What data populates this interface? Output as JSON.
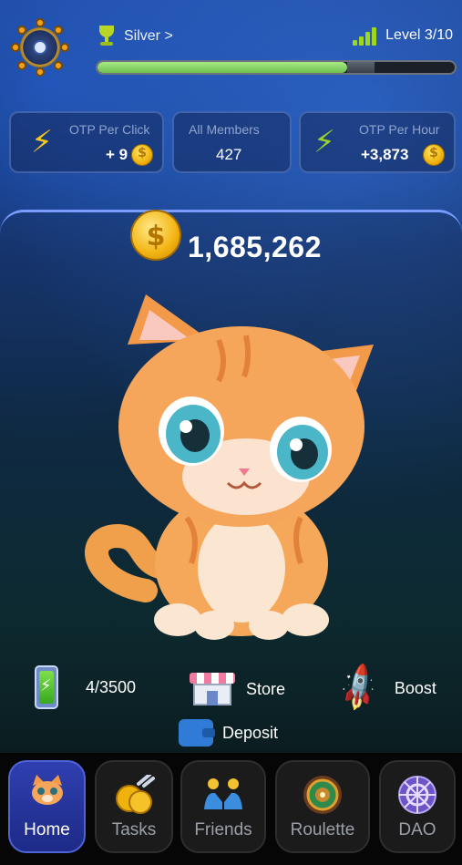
{
  "header": {
    "rank_label": "Silver >",
    "level_label": "Level 3/10",
    "level_progress": 0.7
  },
  "stats": {
    "per_click": {
      "label": "OTP Per Click",
      "value": "+ 9"
    },
    "members": {
      "label": "All Members",
      "value": "427"
    },
    "per_hour": {
      "label": "OTP Per Hour",
      "value": "+3,873"
    }
  },
  "balance": "1,685,262",
  "actions": {
    "energy": "4/3500",
    "store": "Store",
    "boost": "Boost",
    "deposit": "Deposit"
  },
  "nav": [
    {
      "label": "Home",
      "icon": "cat-face-icon",
      "active": true
    },
    {
      "label": "Tasks",
      "icon": "coins-icon",
      "active": false
    },
    {
      "label": "Friends",
      "icon": "friends-icon",
      "active": false
    },
    {
      "label": "Roulette",
      "icon": "roulette-icon",
      "active": false
    },
    {
      "label": "DAO",
      "icon": "dao-icon",
      "active": false
    }
  ],
  "colors": {
    "accent": "#7b9cff",
    "progress": "#8fd86a",
    "coin": "#f0b30d",
    "nav_active": "#2f3fb0"
  }
}
